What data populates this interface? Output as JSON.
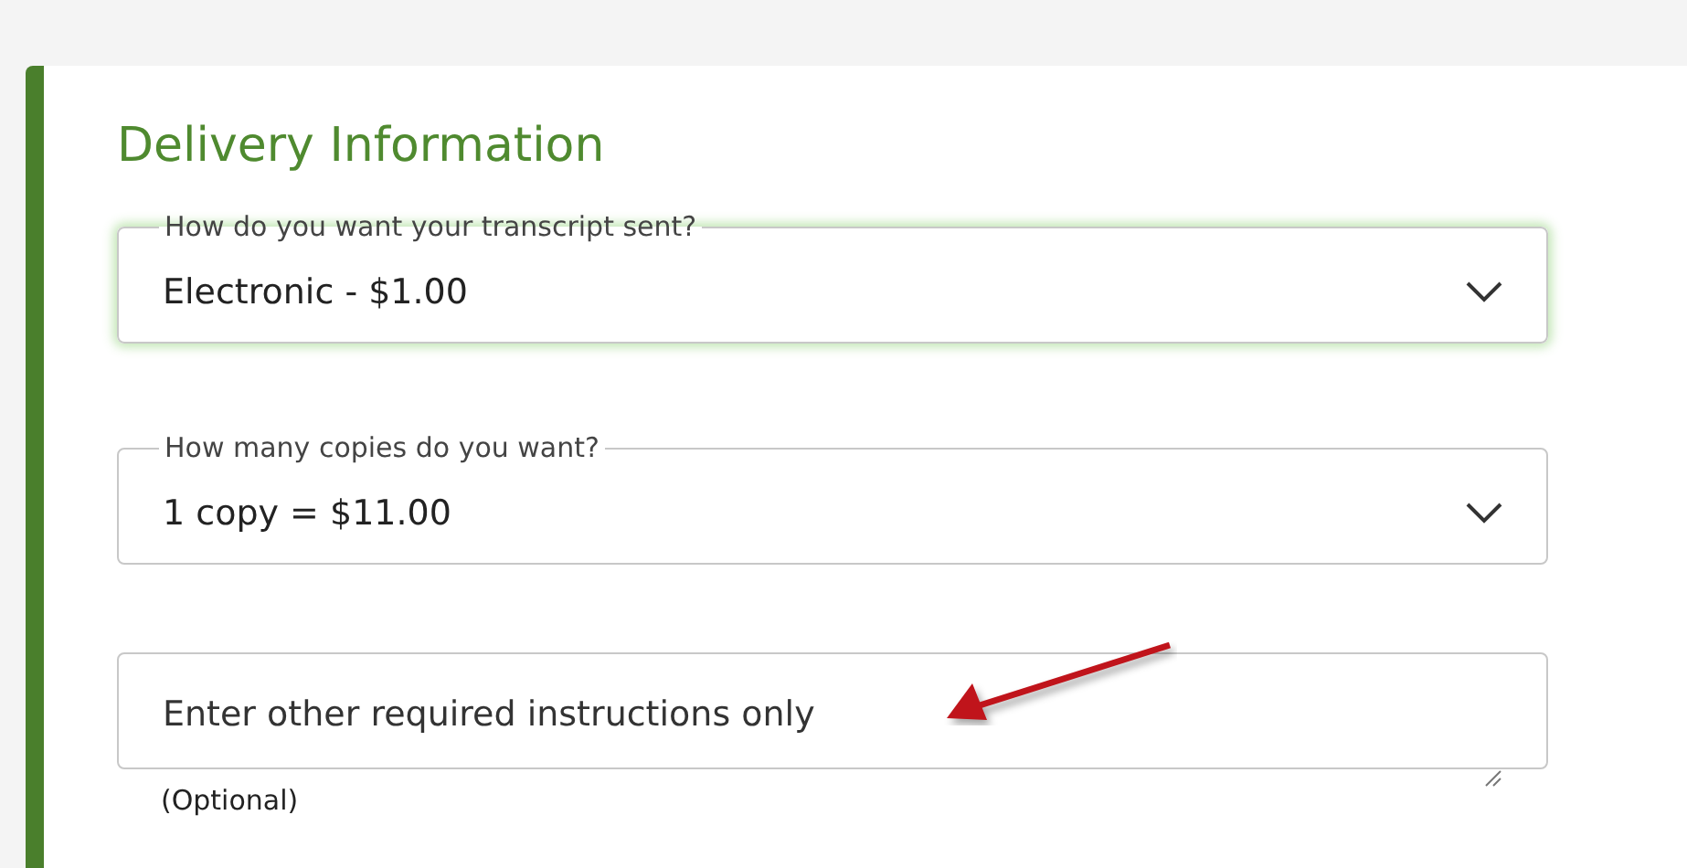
{
  "section": {
    "title": "Delivery Information"
  },
  "fields": [
    {
      "kind": "select",
      "label": "How do you want your transcript sent?",
      "value": "Electronic - $1.00",
      "focused": true
    },
    {
      "kind": "select",
      "label": "How many copies do you want?",
      "value": "1 copy = $11.00",
      "focused": false
    },
    {
      "kind": "textarea",
      "placeholder": "Enter other required instructions only",
      "hint": "(Optional)",
      "focused": false
    }
  ]
}
